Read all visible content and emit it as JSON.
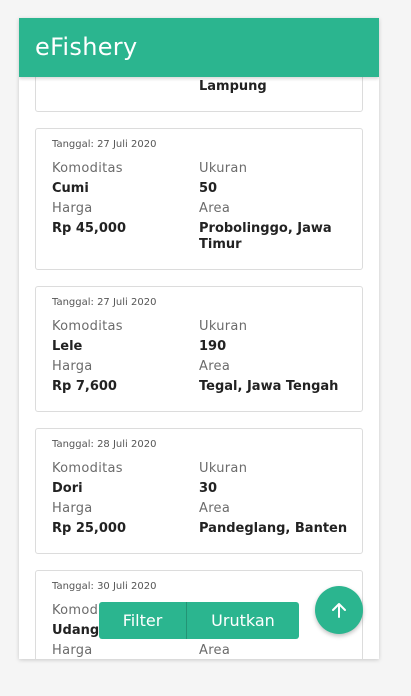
{
  "app": {
    "title": "eFishery"
  },
  "labels": {
    "commodity": "Komoditas",
    "size": "Ukuran",
    "price": "Harga",
    "area": "Area"
  },
  "cards": [
    {
      "area": "Lampung"
    },
    {
      "date": "Tanggal: 27 Juli 2020",
      "commodity": "Cumi",
      "size": "50",
      "price": "Rp 45,000",
      "area": "Probolinggo, Jawa Timur"
    },
    {
      "date": "Tanggal: 27 Juli 2020",
      "commodity": "Lele",
      "size": "190",
      "price": "Rp 7,600",
      "area": "Tegal, Jawa Tengah"
    },
    {
      "date": "Tanggal: 28 Juli 2020",
      "commodity": "Dori",
      "size": "30",
      "price": "Rp 25,000",
      "area": "Pandeglang, Banten"
    },
    {
      "date": "Tanggal: 30 Juli 2020",
      "commodity": "Udang"
    }
  ],
  "actions": {
    "filter": "Filter",
    "sort": "Urutkan"
  },
  "icons": {
    "scroll_top": "arrow-up-icon"
  },
  "colors": {
    "primary": "#2bb58f"
  }
}
